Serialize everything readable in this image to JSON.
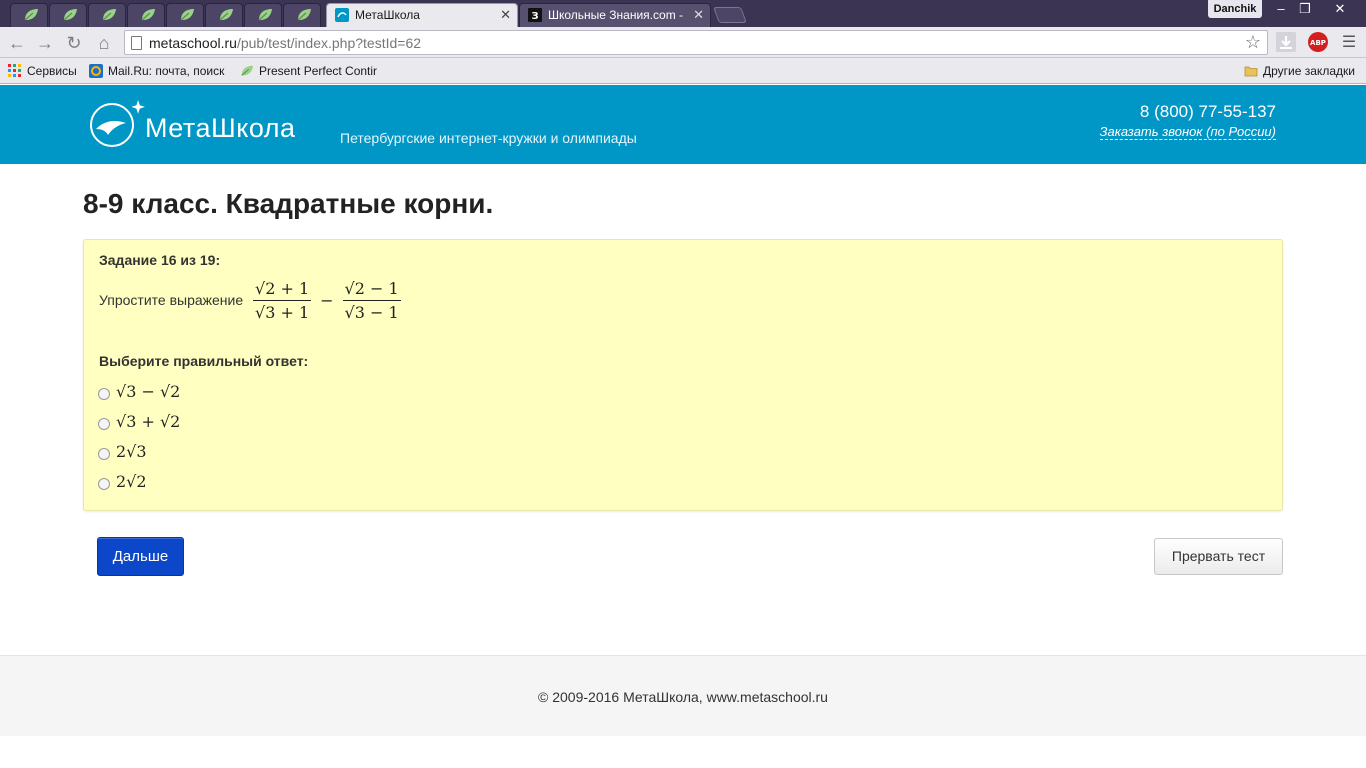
{
  "browser": {
    "tabs": [
      {
        "title": "МетаШкола",
        "active": true
      },
      {
        "title": "Школьные Знания.com -",
        "active": false
      }
    ],
    "profile_name": "Danchik",
    "window_controls": {
      "minimize": "–",
      "restore": "❐",
      "close": "✕"
    },
    "url_host": "metaschool.ru",
    "url_path": "/pub/test/index.php?testId=62",
    "bookmarks": [
      {
        "label": "Сервисы"
      },
      {
        "label": "Mail.Ru: почта, поиск"
      },
      {
        "label": "Present Perfect Contir"
      }
    ],
    "other_bookmarks": "Другие закладки",
    "abp_label": "ABP"
  },
  "site": {
    "logo_text": "МетаШкола",
    "tagline": "Петербургские интернет-кружки и олимпиады",
    "phone": "8 (800) 77-55-137",
    "callback_link": "Заказать звонок (по России)"
  },
  "test": {
    "title": "8-9 класс. Квадратные корни.",
    "task_number": "Задание 16 из 19:",
    "task_text": "Упростите выражение",
    "formula": {
      "frac1_num": "√2 + 1",
      "frac1_den": "√3 + 1",
      "operator": "−",
      "frac2_num": "√2 − 1",
      "frac2_den": "√3 − 1"
    },
    "choose_label": "Выберите правильный ответ:",
    "options": [
      {
        "text": "√3 − √2"
      },
      {
        "text": "√3 + √2"
      },
      {
        "text": "2√3"
      },
      {
        "text": "2√2"
      }
    ],
    "next_button": "Дальше",
    "abort_button": "Прервать тест"
  },
  "footer": {
    "copyright": "© 2009-2016 МетаШкола, www.metaschool.ru"
  },
  "colors": {
    "header_bg": "#0097c6",
    "task_bg": "#ffffc2",
    "next_button_bg": "#0d47c9"
  }
}
